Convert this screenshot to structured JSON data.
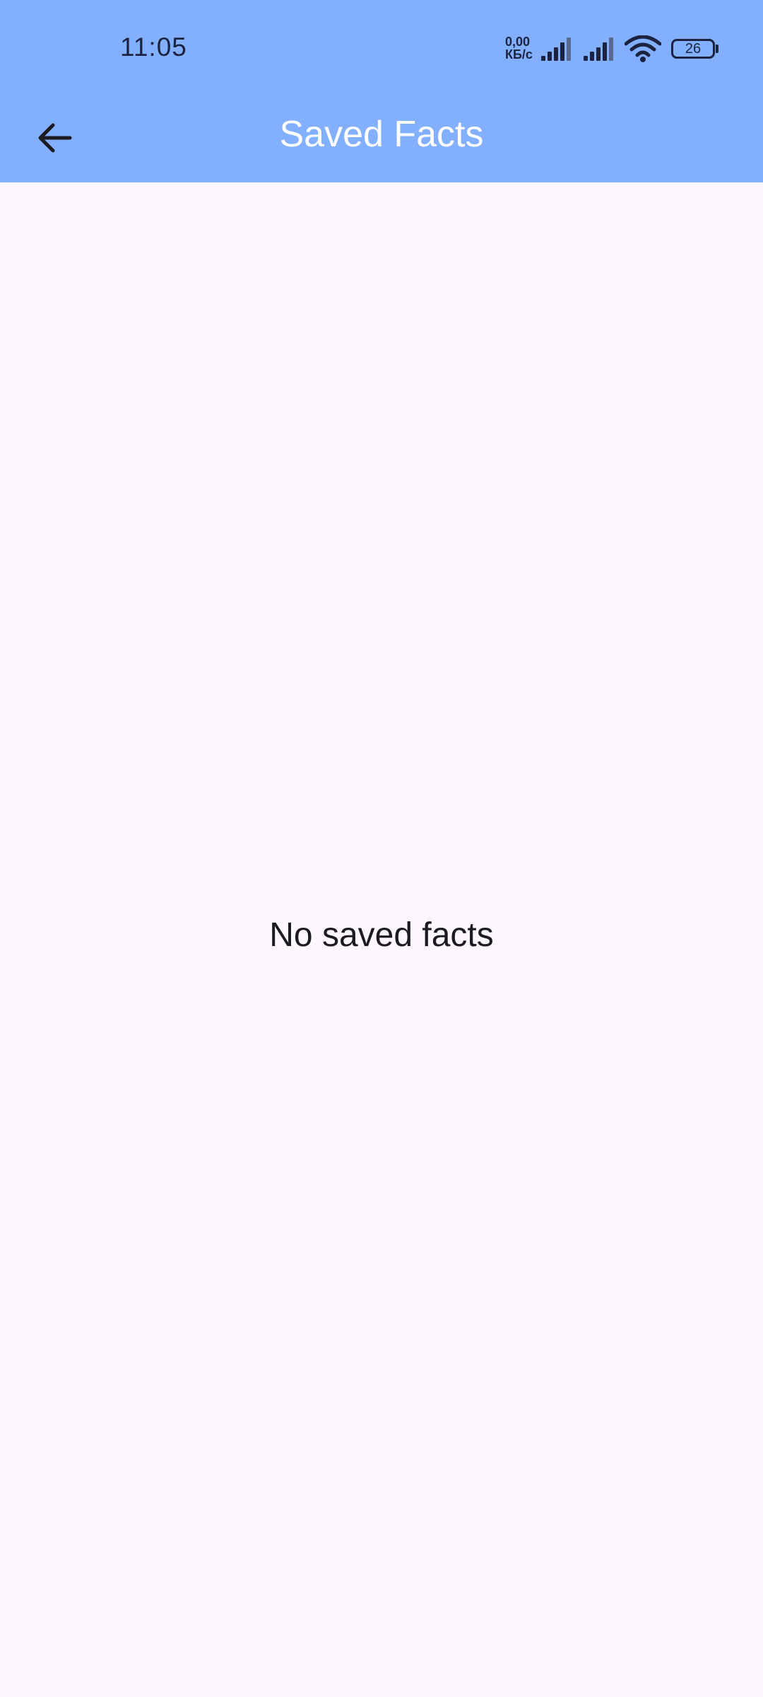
{
  "status_bar": {
    "time": "11:05",
    "net_speed_value": "0,00",
    "net_speed_unit": "КБ/с",
    "battery_level": "26",
    "icons": [
      "signal-icon",
      "signal-icon",
      "wifi-icon",
      "battery-icon"
    ]
  },
  "app_bar": {
    "title": "Saved Facts",
    "back_icon": "arrow-back-icon"
  },
  "main": {
    "empty_message": "No saved facts"
  },
  "colors": {
    "app_bar_background": "#82b0fe",
    "page_background": "#fdf7fe",
    "title_text": "#ffffff",
    "body_text": "#1c1b20"
  }
}
